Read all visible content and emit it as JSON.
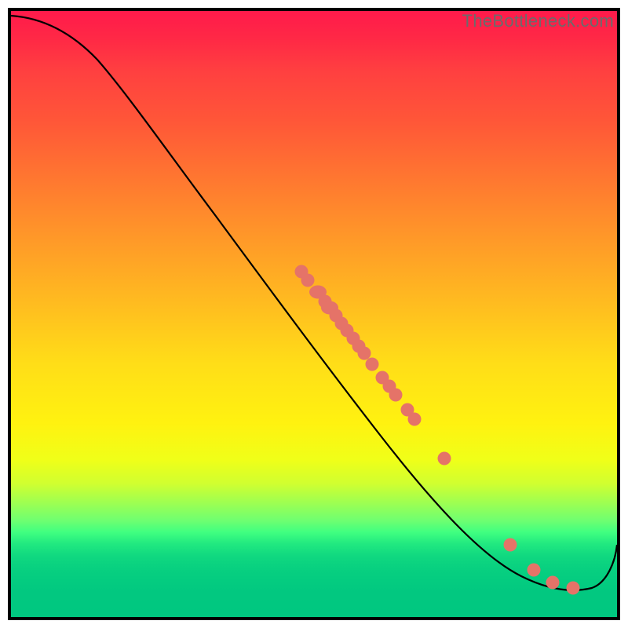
{
  "watermark": "TheBottleneck.com",
  "colors": {
    "dot": "#e57368",
    "curve": "#000000",
    "gradient_top": "#ff1a4b",
    "gradient_bottom": "#00c880"
  },
  "chart_data": {
    "type": "line",
    "title": "",
    "xlabel": "",
    "ylabel": "",
    "xlim": [
      0,
      100
    ],
    "ylim": [
      0,
      100
    ],
    "grid": false,
    "series": [
      {
        "name": "curve",
        "x": [
          0,
          6,
          12,
          20,
          30,
          40,
          50,
          60,
          70,
          80,
          85,
          88,
          92,
          95,
          100
        ],
        "y": [
          100,
          99,
          96,
          88,
          77,
          66,
          55,
          44,
          33,
          21,
          13,
          9,
          6,
          5,
          12
        ]
      }
    ],
    "scatter_points": {
      "name": "highlighted_points",
      "x": [
        48,
        49,
        51,
        52,
        53,
        54,
        55,
        56,
        57,
        58,
        59,
        60,
        62,
        63,
        64,
        66,
        67,
        72,
        83,
        87,
        90,
        93
      ],
      "y": [
        57,
        56,
        55,
        53,
        52,
        51,
        50,
        49,
        48,
        47,
        46,
        44,
        42,
        41,
        40,
        37,
        36,
        30,
        15,
        10,
        7,
        6
      ]
    },
    "annotations": []
  }
}
